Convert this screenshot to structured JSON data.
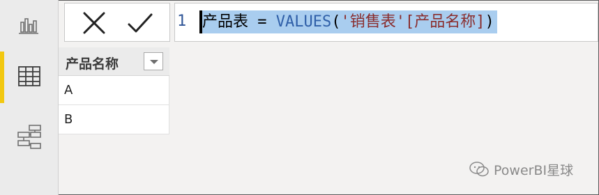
{
  "formula": {
    "line_number": "1",
    "table_name": "产品表",
    "operator": " = ",
    "function": "VALUES",
    "open_paren": "(",
    "argument_table": "'销售表'",
    "argument_column": "[产品名称]",
    "close_paren": ")"
  },
  "formula_buttons": {
    "cancel_icon": "close-icon",
    "confirm_icon": "check-icon"
  },
  "nav": {
    "items": [
      {
        "icon": "report-view-icon",
        "active": false
      },
      {
        "icon": "data-view-icon",
        "active": true
      },
      {
        "icon": "model-view-icon",
        "active": false
      }
    ]
  },
  "table": {
    "column_header": "产品名称",
    "rows": [
      "A",
      "B"
    ]
  },
  "watermark": {
    "text": "PowerBI星球"
  },
  "colors": {
    "accent": "#f2c811",
    "selection": "#a9cdef",
    "function_blue": "#2f5fa8"
  }
}
